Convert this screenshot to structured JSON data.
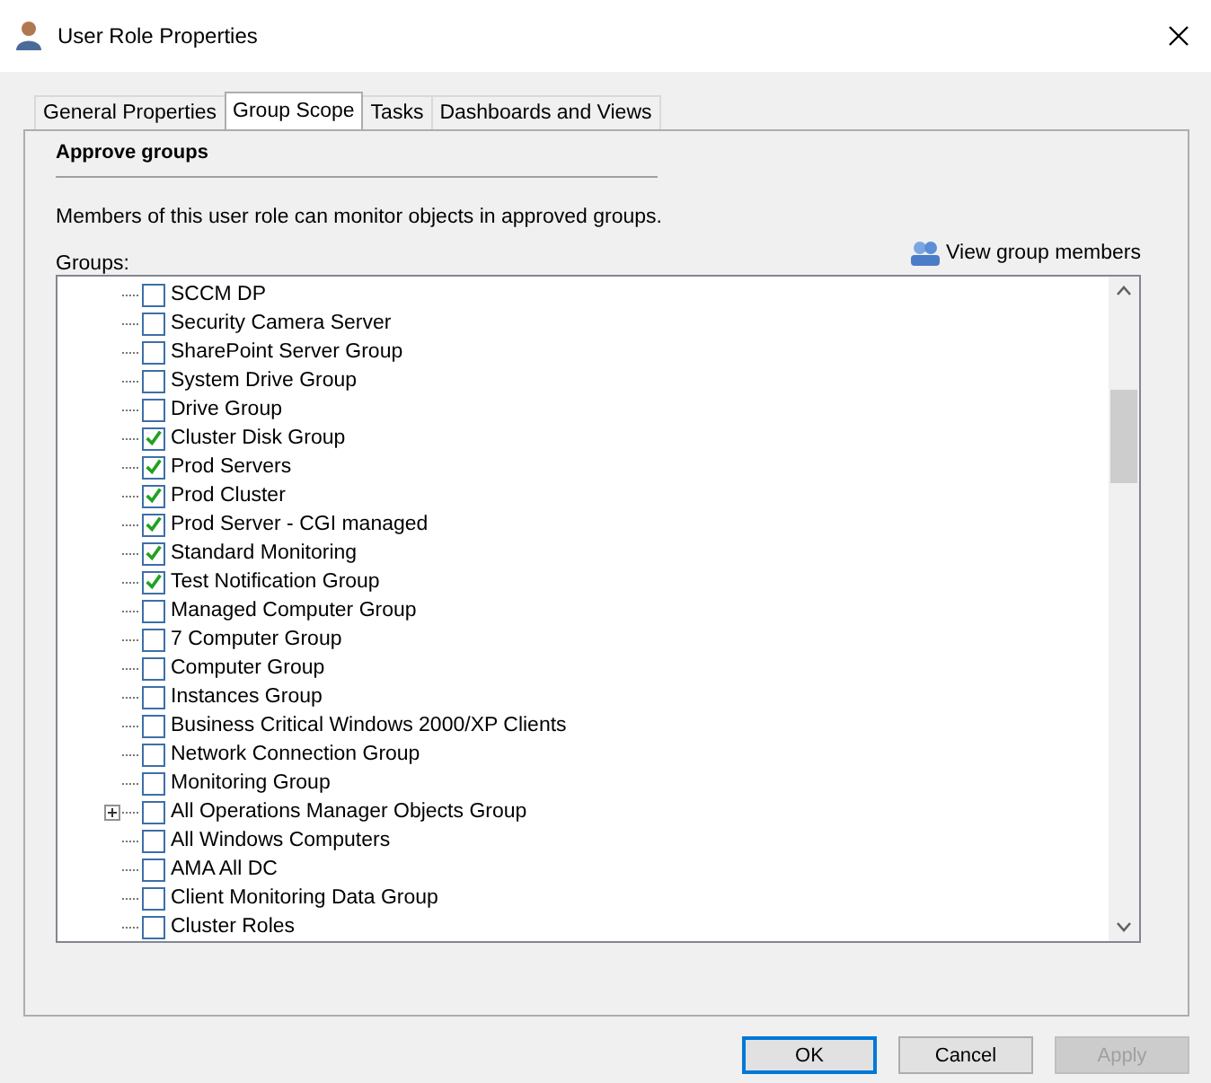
{
  "window": {
    "title": "User Role Properties"
  },
  "tabs": [
    {
      "label": "General Properties",
      "selected": false
    },
    {
      "label": "Group Scope",
      "selected": true
    },
    {
      "label": "Tasks",
      "selected": false
    },
    {
      "label": "Dashboards and Views",
      "selected": false
    }
  ],
  "section": {
    "heading": "Approve groups",
    "description": "Members of this user role can monitor objects in approved groups.",
    "groups_label": "Groups:",
    "view_members_link": "View group members"
  },
  "groups": [
    {
      "name": "SCCM DP",
      "checked": false,
      "expandable": false
    },
    {
      "name": "Security Camera Server",
      "checked": false,
      "expandable": false
    },
    {
      "name": "SharePoint Server Group",
      "checked": false,
      "expandable": false
    },
    {
      "name": "System Drive Group",
      "checked": false,
      "expandable": false
    },
    {
      "name": "Drive Group",
      "checked": false,
      "expandable": false
    },
    {
      "name": "Cluster Disk Group",
      "checked": true,
      "expandable": false
    },
    {
      "name": "Prod Servers",
      "checked": true,
      "expandable": false
    },
    {
      "name": "Prod Cluster",
      "checked": true,
      "expandable": false
    },
    {
      "name": "Prod Server - CGI managed",
      "checked": true,
      "expandable": false
    },
    {
      "name": "Standard Monitoring",
      "checked": true,
      "expandable": false
    },
    {
      "name": "Test Notification Group",
      "checked": true,
      "expandable": false
    },
    {
      "name": "Managed Computer Group",
      "checked": false,
      "expandable": false
    },
    {
      "name": "7 Computer Group",
      "checked": false,
      "expandable": false
    },
    {
      "name": "Computer Group",
      "checked": false,
      "expandable": false
    },
    {
      "name": "Instances Group",
      "checked": false,
      "expandable": false
    },
    {
      "name": "Business Critical Windows 2000/XP Clients",
      "checked": false,
      "expandable": false
    },
    {
      "name": "Network Connection Group",
      "checked": false,
      "expandable": false
    },
    {
      "name": "Monitoring Group",
      "checked": false,
      "expandable": false
    },
    {
      "name": "All Operations Manager Objects Group",
      "checked": false,
      "expandable": true
    },
    {
      "name": "All Windows Computers",
      "checked": false,
      "expandable": false
    },
    {
      "name": "AMA All DC",
      "checked": false,
      "expandable": false
    },
    {
      "name": "Client Monitoring Data Group",
      "checked": false,
      "expandable": false
    },
    {
      "name": "Cluster Roles",
      "checked": false,
      "expandable": false
    }
  ],
  "buttons": [
    {
      "label": "OK",
      "kind": "default",
      "disabled": false
    },
    {
      "label": "Cancel",
      "kind": "normal",
      "disabled": false
    },
    {
      "label": "Apply",
      "kind": "normal",
      "disabled": true
    }
  ]
}
